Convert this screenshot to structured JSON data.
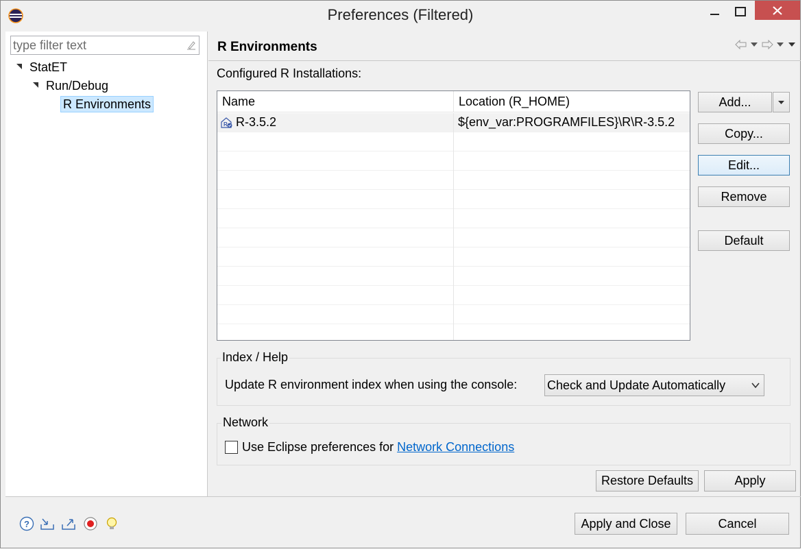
{
  "window": {
    "title": "Preferences (Filtered)"
  },
  "filter": {
    "placeholder": "type filter text"
  },
  "tree": {
    "items": [
      {
        "label": "StatET"
      },
      {
        "label": "Run/Debug"
      },
      {
        "label": "R Environments"
      }
    ]
  },
  "page": {
    "title": "R Environments",
    "installations_label": "Configured R Installations:"
  },
  "table": {
    "columns": [
      "Name",
      "Location (R_HOME)"
    ],
    "rows": [
      {
        "name": "R-3.5.2",
        "location": "${env_var:PROGRAMFILES}\\R\\R-3.5.2"
      }
    ]
  },
  "buttons": {
    "add": "Add...",
    "copy": "Copy...",
    "edit": "Edit...",
    "remove": "Remove",
    "default": "Default",
    "restore_defaults": "Restore Defaults",
    "apply": "Apply",
    "apply_and_close": "Apply and Close",
    "cancel": "Cancel"
  },
  "index_group": {
    "title": "Index / Help",
    "label": "Update R environment index when using the console:",
    "selected": "Check and Update Automatically"
  },
  "network_group": {
    "title": "Network",
    "checkbox_label": "Use Eclipse preferences for",
    "link": "Network Connections",
    "checked": false
  },
  "bottom_icons": [
    "help-icon",
    "import-icon",
    "export-icon",
    "record-icon",
    "tip-icon"
  ],
  "colors": {
    "close_button": "#c75050",
    "link": "#0066cc",
    "selection": "#cce8ff"
  }
}
